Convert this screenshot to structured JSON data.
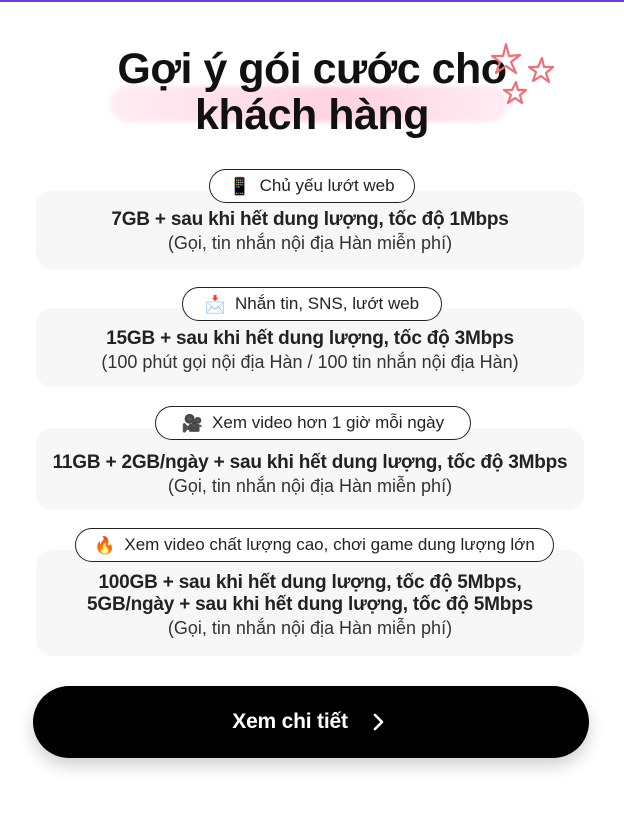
{
  "title": {
    "line1": "Gợi ý gói cước cho",
    "line2": "khách hàng"
  },
  "plans": [
    {
      "pill": {
        "icon": "📱",
        "icon_name": "mobile-phone-icon",
        "label": "Chủ yếu lướt web"
      },
      "main": [
        "7GB + sau khi hết dung lượng, tốc độ 1Mbps"
      ],
      "sub": "(Gọi, tin nhắn nội địa Hàn miễn phí)"
    },
    {
      "pill": {
        "icon": "📩",
        "icon_name": "envelope-icon",
        "label": "Nhắn tin, SNS, lướt web"
      },
      "main": [
        "15GB + sau khi hết dung lượng, tốc độ 3Mbps"
      ],
      "sub": "(100 phút gọi nội địa Hàn / 100 tin nhắn nội địa Hàn)"
    },
    {
      "pill": {
        "icon": "🎥",
        "icon_name": "video-camera-icon",
        "label": "Xem video hơn 1 giờ mỗi ngày"
      },
      "main": [
        "11GB + 2GB/ngày + sau khi hết dung lượng, tốc độ 3Mbps"
      ],
      "sub": "(Gọi, tin nhắn nội địa Hàn miễn phí)"
    },
    {
      "pill": {
        "icon": "🔥",
        "icon_name": "fire-icon",
        "label": "Xem video chất lượng cao, chơi game dung lượng lớn"
      },
      "main": [
        "100GB + sau khi hết dung lượng, tốc độ 5Mbps,",
        "5GB/ngày + sau khi hết dung lượng, tốc độ 5Mbps"
      ],
      "sub": "(Gọi, tin nhắn nội địa Hàn miễn phí)"
    }
  ],
  "cta": {
    "label": "Xem chi tiết",
    "icon": "chevron-right-icon"
  },
  "colors": {
    "accent_line": "#6a3fd1",
    "star": "#f0707a",
    "highlight": "#ffd3e0",
    "cta_bg": "#000000"
  }
}
